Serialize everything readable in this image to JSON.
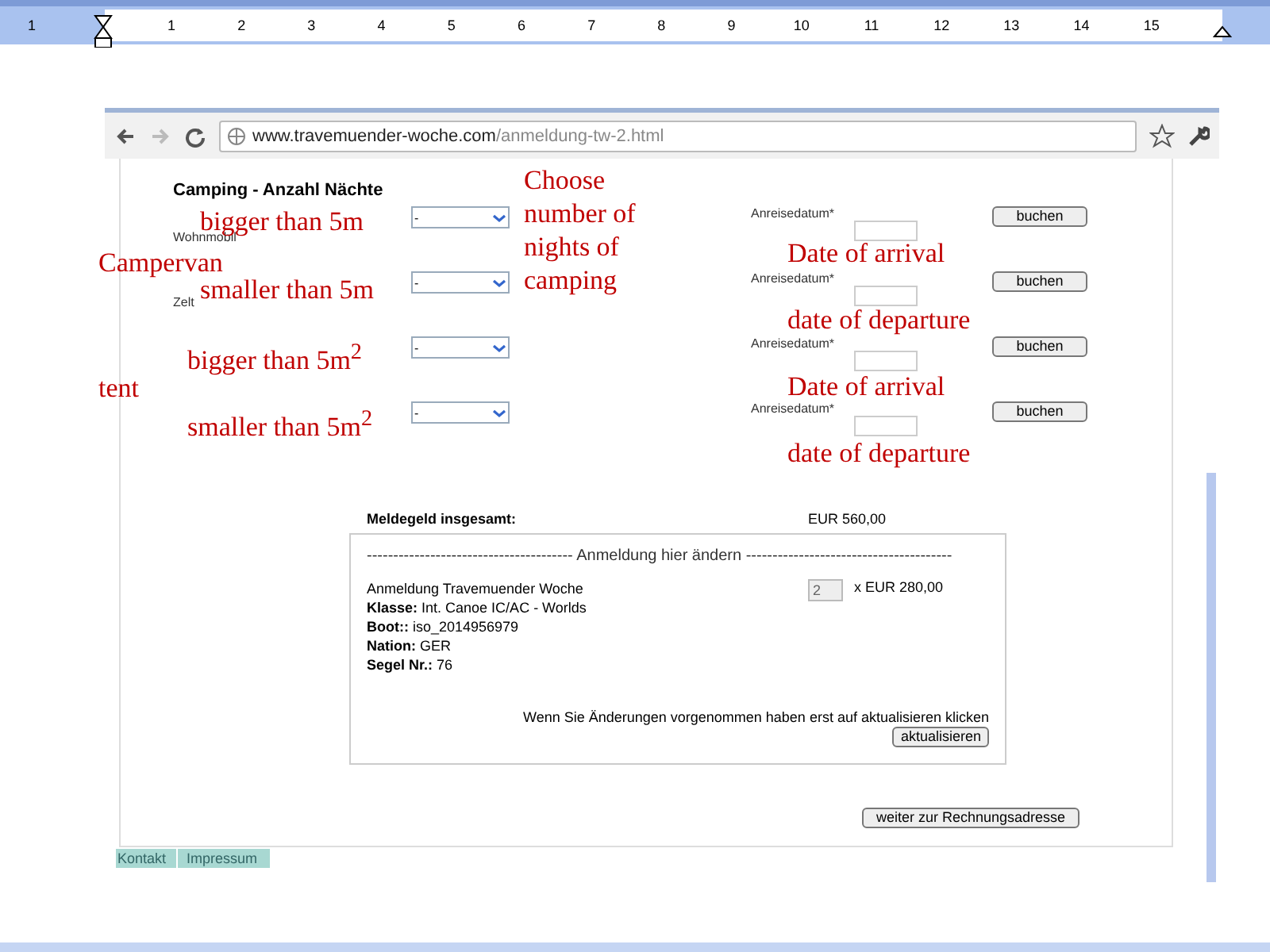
{
  "ruler": {
    "numbers": [
      "1",
      "1",
      "2",
      "3",
      "4",
      "5",
      "6",
      "7",
      "8",
      "9",
      "10",
      "11",
      "12",
      "13",
      "14",
      "15"
    ]
  },
  "browser": {
    "url_host": "www.travemuender-woche.com",
    "url_path": "/anmeldung-tw-2.html"
  },
  "camping": {
    "title": "Camping - Anzahl Nächte",
    "rows": [
      {
        "label": "Wohnmobil",
        "select": "-",
        "date_label": "Anreisedatum*",
        "button": "buchen"
      },
      {
        "label": "Zelt",
        "select": "-",
        "date_label": "Anreisedatum*",
        "button": "buchen"
      },
      {
        "select": "-",
        "date_label": "Anreisedatum*",
        "button": "buchen"
      },
      {
        "select": "-",
        "date_label": "Anreisedatum*",
        "button": "buchen"
      }
    ]
  },
  "total": {
    "label": "Meldegeld insgesamt:",
    "value": "EUR 560,00"
  },
  "change_box": {
    "legend": "--------------------------------------- Anmeldung hier ändern ---------------------------------------",
    "lines": [
      "Anmeldung Travemuender Woche",
      "**Klasse:** Int. Canoe IC/AC - Worlds",
      "**Boot::** iso_2014956979",
      "**Nation:** GER",
      "**Segel Nr.:** 76"
    ],
    "quantity": "2",
    "price": "x EUR 280,00",
    "hint": "Wenn Sie Änderungen vorgenommen haben erst auf aktualisieren klicken",
    "button": "aktualisieren"
  },
  "next_button": "weiter zur Rechnungsadresse",
  "footer_links": [
    "Kontakt",
    "Impressum"
  ],
  "annotations": [
    "bigger than 5m",
    "Campervan",
    "smaller than 5m",
    "bigger than 5m$^{2}$",
    "tent",
    "smaller than 5m$^{2}$",
    "Choose number of nights of camping",
    "Date of arrival",
    "date of departure",
    "Date of arrival",
    "date of departure"
  ]
}
